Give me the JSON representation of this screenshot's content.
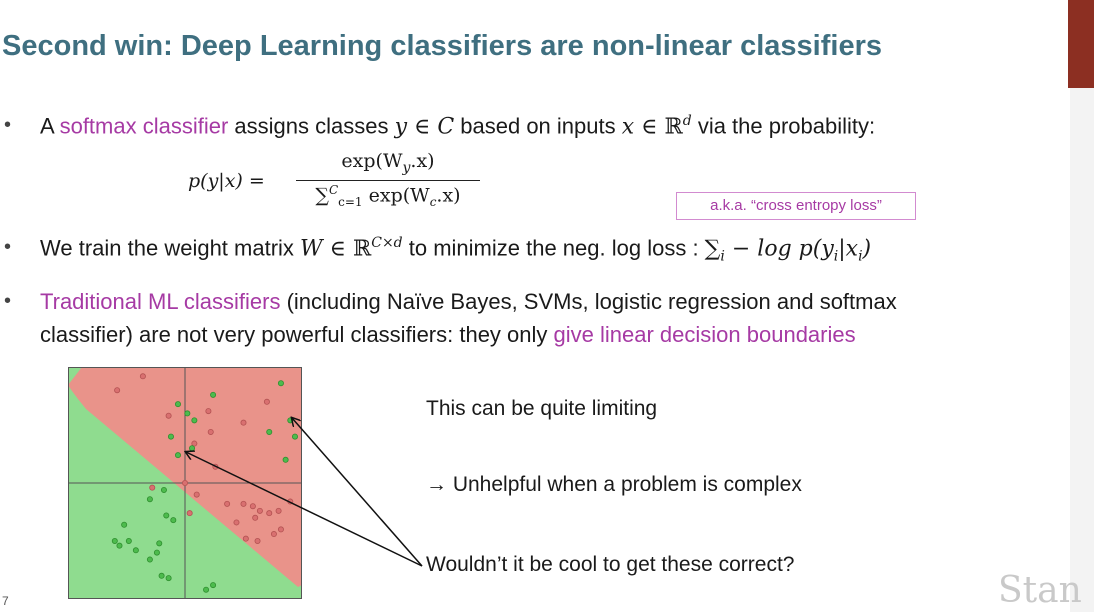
{
  "slide": {
    "title": "Second win: Deep Learning classifiers are non-linear classifiers",
    "bullet1": {
      "pre": "A ",
      "highlight": "softmax classifier",
      "mid": " assigns classes ",
      "y": "y",
      "in1": " ∈ ",
      "C": "C",
      "mid2": " based on inputs ",
      "x": "x",
      "in2": " ∈ ",
      "R": "ℝ",
      "d": "d",
      "post": " via the probability:"
    },
    "formula": {
      "lhs": "p(y|x) =",
      "num": "exp(W",
      "num_sub": "y",
      "num_end": ".x)",
      "den_sum": "∑",
      "den_sup": "C",
      "den_sub": "c=1",
      "den_rest": " exp(W",
      "den_sub2": "c",
      "den_end": ".x)"
    },
    "aka": "a.k.a. “cross entropy loss”",
    "bullet2": {
      "pre": "We train the weight matrix ",
      "W": "W",
      "in": " ∈ ",
      "R": "ℝ",
      "exp": "C×d",
      "mid": " to minimize the neg. log loss : ",
      "sum": "∑",
      "i": "i",
      "rest": " − log p(y",
      "yi": "i",
      "bar": "|x",
      "xi": "i",
      "close": ")"
    },
    "bullet3": {
      "highlight1": "Traditional ML classifiers",
      "text1": " (including Naïve Bayes, SVMs, logistic regression and softmax",
      "text2": "classifier) are not very powerful classifiers: they only ",
      "highlight2": "give linear decision boundaries"
    },
    "notes": {
      "n1": "This can be quite limiting",
      "n2": "→ Unhelpful when a problem is complex",
      "n3": "Wouldn’t it be cool to get these correct?"
    },
    "watermark": "Stan",
    "page_mark": "7",
    "bullet_glyph": "•"
  },
  "colors": {
    "title": "#3f6f80",
    "highlight": "#a63aa4",
    "green_region": "#8fdc8f",
    "red_region": "#e9938a",
    "green_point": "#4dbb4d",
    "red_point": "#d97070"
  },
  "plot": {
    "red_points": [
      [
        0.21,
        0.1
      ],
      [
        0.32,
        0.04
      ],
      [
        0.43,
        0.21
      ],
      [
        0.6,
        0.19
      ],
      [
        0.75,
        0.24
      ],
      [
        0.85,
        0.15
      ],
      [
        0.61,
        0.28
      ],
      [
        0.54,
        0.33
      ],
      [
        0.36,
        0.52
      ],
      [
        0.5,
        0.5
      ],
      [
        0.55,
        0.55
      ],
      [
        0.63,
        0.43
      ],
      [
        0.68,
        0.59
      ],
      [
        0.72,
        0.67
      ],
      [
        0.75,
        0.59
      ],
      [
        0.79,
        0.6
      ],
      [
        0.82,
        0.62
      ],
      [
        0.86,
        0.63
      ],
      [
        0.9,
        0.62
      ],
      [
        0.76,
        0.74
      ],
      [
        0.81,
        0.75
      ],
      [
        0.88,
        0.72
      ],
      [
        0.91,
        0.7
      ],
      [
        0.8,
        0.65
      ],
      [
        0.95,
        0.58
      ],
      [
        0.52,
        0.63
      ]
    ],
    "green_points": [
      [
        0.47,
        0.16
      ],
      [
        0.51,
        0.2
      ],
      [
        0.62,
        0.12
      ],
      [
        0.54,
        0.23
      ],
      [
        0.44,
        0.3
      ],
      [
        0.47,
        0.38
      ],
      [
        0.53,
        0.35
      ],
      [
        0.91,
        0.07
      ],
      [
        0.95,
        0.23
      ],
      [
        0.97,
        0.3
      ],
      [
        0.93,
        0.4
      ],
      [
        0.86,
        0.28
      ],
      [
        0.42,
        0.64
      ],
      [
        0.45,
        0.66
      ],
      [
        0.41,
        0.53
      ],
      [
        0.35,
        0.57
      ],
      [
        0.24,
        0.68
      ],
      [
        0.26,
        0.75
      ],
      [
        0.29,
        0.79
      ],
      [
        0.35,
        0.83
      ],
      [
        0.38,
        0.8
      ],
      [
        0.39,
        0.76
      ],
      [
        0.22,
        0.77
      ],
      [
        0.2,
        0.75
      ],
      [
        0.4,
        0.9
      ],
      [
        0.43,
        0.91
      ],
      [
        0.62,
        0.94
      ],
      [
        0.59,
        0.96
      ]
    ]
  }
}
